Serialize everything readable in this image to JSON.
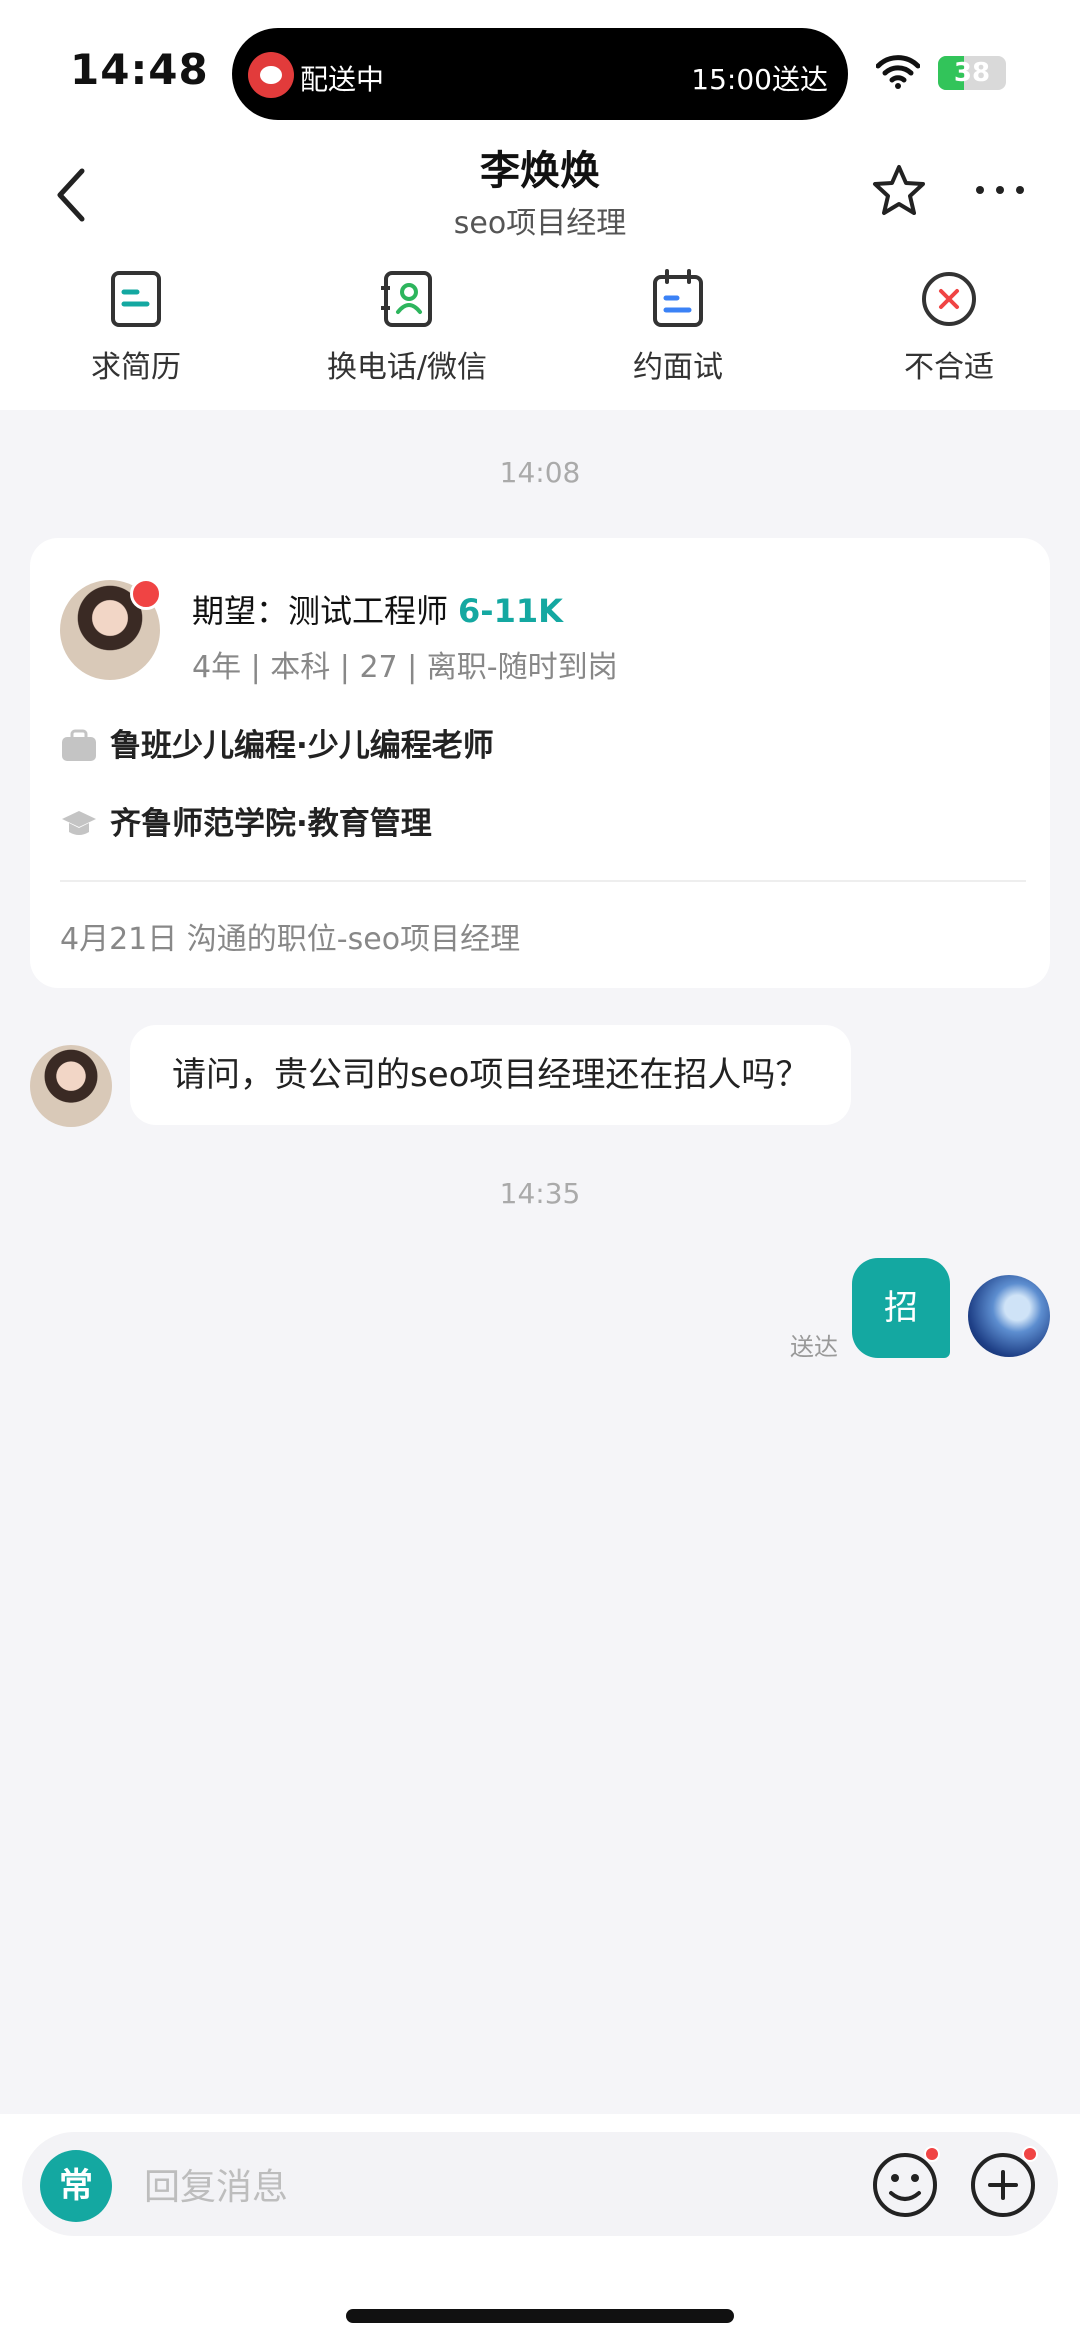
{
  "status_bar": {
    "time": "14:48",
    "live_activity": {
      "left_text": "配送中",
      "right_text": "15:00送达"
    },
    "battery_level": "38",
    "battery_fraction": 0.38
  },
  "nav": {
    "title": "李焕焕",
    "subtitle": "seo项目经理"
  },
  "actions": [
    {
      "label": "求简历",
      "icon": "resume-icon"
    },
    {
      "label": "换电话/微信",
      "icon": "contact-icon"
    },
    {
      "label": "约面试",
      "icon": "calendar-icon"
    },
    {
      "label": "不合适",
      "icon": "close-circle-icon"
    }
  ],
  "chat": {
    "time_1": "14:08",
    "card": {
      "expect_label": "期望：测试工程师",
      "salary": "6-11K",
      "meta": "4年 | 本科 | 27 | 离职-随时到岗",
      "work": "鲁班少儿编程·少儿编程老师",
      "education": "齐鲁师范学院·教育管理",
      "footer": "4月21日 沟通的职位-seo项目经理"
    },
    "incoming_message": "请问，贵公司的seo项目经理还在招人吗？",
    "time_2": "14:35",
    "outgoing_message": "招",
    "outgoing_status": "送达"
  },
  "composer": {
    "common_label": "常",
    "placeholder": "回复消息"
  },
  "colors": {
    "accent": "#14a8a1",
    "badge": "#f04444",
    "background": "#f5f5f8"
  }
}
